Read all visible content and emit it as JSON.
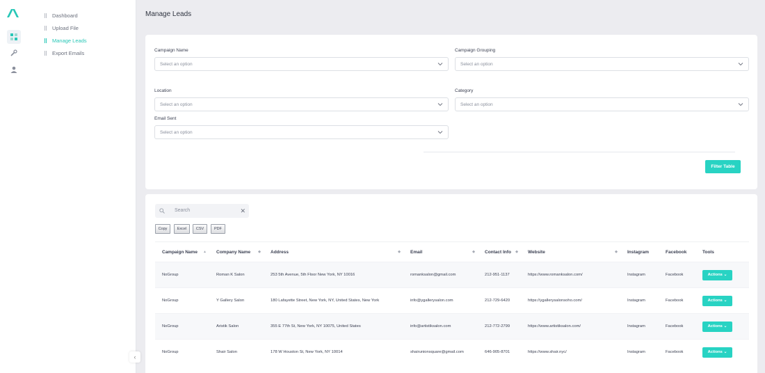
{
  "sidebar": {
    "nav": [
      {
        "label": "Dashboard"
      },
      {
        "label": "Upload File"
      },
      {
        "label": "Manage Leads"
      },
      {
        "label": "Export Emails"
      }
    ]
  },
  "page": {
    "title": "Manage Leads"
  },
  "filters": {
    "campaign_name": {
      "label": "Campaign Name",
      "placeholder": "Select an option"
    },
    "campaign_grouping": {
      "label": "Campaign Grouping",
      "placeholder": "Select an option"
    },
    "location": {
      "label": "Location",
      "placeholder": "Select an option"
    },
    "category": {
      "label": "Category",
      "placeholder": "Select an option"
    },
    "email_sent": {
      "label": "Email Sent",
      "placeholder": "Select an option"
    },
    "filter_button": "Filter Table"
  },
  "table_tools": {
    "search_placeholder": "Search",
    "export_buttons": [
      "Copy",
      "Excel",
      "CSV",
      "PDF"
    ]
  },
  "table": {
    "columns": [
      "Campaign Name",
      "Company Name",
      "Address",
      "Email",
      "Contact Info",
      "Website",
      "Instagram",
      "Facebook",
      "Tools"
    ],
    "rows": [
      {
        "campaign": "NoGroup",
        "company": "Roman K Salon",
        "address": "253 5th Avenue, 5th Floor New York, NY 10016",
        "email": "romanksalon@gmail.com",
        "contact": "212-951-1137",
        "website": "https://www.romanksalon.com/",
        "instagram": "Instagram",
        "facebook": "Facebook",
        "action": "Actions"
      },
      {
        "campaign": "NoGroup",
        "company": "Y Gallery Salon",
        "address": "180 Lafayette Street, New York, NY, United States, New York",
        "email": "info@ygallerysalon.com",
        "contact": "212-729-6420",
        "website": "https://ygallerysalonsoho.com/",
        "instagram": "Instagram",
        "facebook": "Facebook",
        "action": "Actions"
      },
      {
        "campaign": "NoGroup",
        "company": "Aristik Salon",
        "address": "355 E 77th St, New York, NY 10075, United States",
        "email": "info@artistiksalon.com",
        "contact": "212-772-2799",
        "website": "https://www.artistiksalon.com/",
        "instagram": "Instagram",
        "facebook": "Facebook",
        "action": "Actions"
      },
      {
        "campaign": "NoGroup",
        "company": "Shair Salon",
        "address": "178 W Houston St, New York, NY 10014",
        "email": "shairunionsquare@gmail.com",
        "contact": "646-905-8701",
        "website": "https://www.shair.nyc/",
        "instagram": "Instagram",
        "facebook": "Facebook",
        "action": "Actions"
      }
    ]
  },
  "colors": {
    "accent": "#28d3c3",
    "background": "#ececf0"
  }
}
